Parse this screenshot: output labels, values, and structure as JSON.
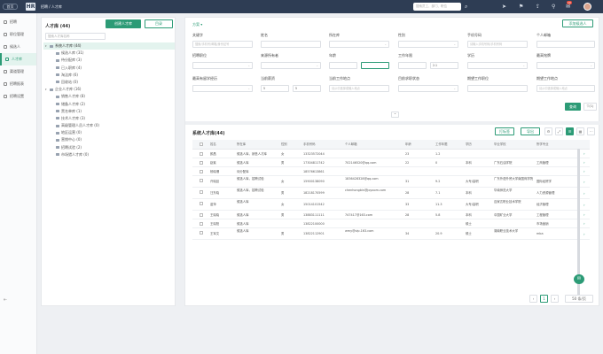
{
  "topbar": {
    "home_label": "首页",
    "logo": "HR",
    "breadcrumb": "招聘 / 人才库",
    "search_placeholder": "搜索员工、部门、职位",
    "notification_count": "10"
  },
  "nav": {
    "items": [
      {
        "label": "招聘",
        "name": "nav-recruit"
      },
      {
        "label": "职位管理",
        "name": "nav-jobs"
      },
      {
        "label": "候选人",
        "name": "nav-candidates"
      },
      {
        "label": "人才库",
        "name": "nav-talent-pool"
      },
      {
        "label": "渠道管理",
        "name": "nav-channels"
      },
      {
        "label": "招聘报表",
        "name": "nav-reports"
      },
      {
        "label": "招聘设置",
        "name": "nav-settings"
      }
    ]
  },
  "talent_panel": {
    "title": "人才库 (44)",
    "create_button": "创建人才库",
    "folder_button": "目录",
    "search_placeholder": "搜索人才库名称",
    "tree": [
      {
        "label": "系统人才库 (44)",
        "level": 1,
        "selected": true
      },
      {
        "label": "候选人库 (31)",
        "level": 2
      },
      {
        "label": "待分配库 (3)",
        "level": 2
      },
      {
        "label": "已入职库 (4)",
        "level": 2
      },
      {
        "label": "淘汰库 (6)",
        "level": 2
      },
      {
        "label": "回收站 (0)",
        "level": 2
      },
      {
        "label": "企业人才库 (16)",
        "level": 1
      },
      {
        "label": "销售人才库 (8)",
        "level": 2
      },
      {
        "label": "储备人才库 (2)",
        "level": 2
      },
      {
        "label": "黑名单库 (1)",
        "level": 2
      },
      {
        "label": "技术人才库 (3)",
        "level": 2
      },
      {
        "label": "高级管理人员人才库 (0)",
        "level": 2
      },
      {
        "label": "地区运营 (0)",
        "level": 2
      },
      {
        "label": "营销中心 (0)",
        "level": 2
      },
      {
        "label": "招聘试验 (2)",
        "level": 2
      },
      {
        "label": "市场猎人才库 (0)",
        "level": 2
      }
    ]
  },
  "filters": {
    "scheme_label": "方案 ▾",
    "add_candidate": "添加候选人",
    "rows": [
      [
        {
          "label": "关键字",
          "placeholder": "搜索/手机号/邮箱/身份证号",
          "select": false
        },
        {
          "label": "姓名",
          "placeholder": "",
          "select": false
        },
        {
          "label": "所在库",
          "placeholder": "",
          "select": true
        },
        {
          "label": "性别",
          "placeholder": "",
          "select": true
        },
        {
          "label": "手机号码",
          "placeholder": "请输入手机号码/手机号码",
          "select": false
        },
        {
          "label": "个人邮箱",
          "placeholder": "",
          "select": false
        }
      ],
      [
        {
          "label": "招聘职位",
          "placeholder": "",
          "select": true
        },
        {
          "label": "来源所有者",
          "placeholder": "",
          "select": true
        },
        {
          "label": "年龄",
          "placeholder": "",
          "select": false
        },
        {
          "label": "工作年限",
          "placeholder": "",
          "select": false
        },
        {
          "label": "学历",
          "placeholder": "",
          "select": true
        },
        {
          "label": "最高铭牌",
          "placeholder": "",
          "select": true
        }
      ],
      [
        {
          "label": "最高有留学经历",
          "placeholder": "",
          "select": true
        },
        {
          "label": "当前薪资",
          "placeholder": "",
          "select": false
        },
        {
          "label": "当前工作地点",
          "placeholder": "请从中选择或输入地点",
          "select": false
        },
        {
          "label": "目前求职状态",
          "placeholder": "",
          "select": true
        },
        {
          "label": "期望工作职位",
          "placeholder": "",
          "select": false
        },
        {
          "label": "期望工作地点",
          "placeholder": "请从中选择或输入地点",
          "select": false
        }
      ]
    ],
    "age_min": "",
    "age_max": "",
    "exp_min": "",
    "exp_max": "2.1",
    "salary_min": "5",
    "salary_max": "5",
    "query_button": "查询",
    "filter_button": "▽(1)"
  },
  "table": {
    "title": "系统人才库(44)",
    "tag_button": "打标签",
    "export_button": "导出",
    "headers": [
      "姓名",
      "所在库",
      "性别",
      "手机号码",
      "个人邮箱",
      "年龄",
      "工作年限",
      "学历",
      "毕业学校",
      "所学专业"
    ],
    "rows": [
      [
        "颜昌",
        "候选人库，销售人才库",
        "女",
        "13323572044",
        "",
        "23",
        "1.2",
        "",
        "",
        ""
      ],
      [
        "赵紫",
        "候选人库",
        "男",
        "17304811742",
        "702146520@qq.com",
        "22",
        "0",
        "本科",
        "广东石油学院",
        "工商管理"
      ],
      [
        "杨晓珊",
        "待分配库",
        "",
        "18576613861",
        "",
        "",
        "",
        "",
        "",
        ""
      ],
      [
        "许晓廷",
        "候选人库，招聘试验",
        "女",
        "15900138090",
        "1836428328@qq.com",
        "31",
        "9.2",
        "大专/高职",
        "广东外语外贸大学南国商学院",
        "国际经贸学"
      ],
      [
        "汪东晓",
        "候选人库，招聘试验",
        "男",
        "18218170599",
        "chenhongbin@joyoom.com",
        "28",
        "7.1",
        "本科",
        "华南师范大学",
        "人力资源管理"
      ],
      [
        "苗萍",
        "候选人库",
        "女",
        "15014101542",
        "",
        "33",
        "11.3",
        "大专/高职",
        "百家达职业技术学院",
        "经济管理"
      ],
      [
        "王晓晓",
        "候选人库",
        "男",
        "13883111111",
        "747417@163.com",
        "28",
        "5.8",
        "本科",
        "中国矿业大学",
        "工程管理"
      ],
      [
        "王晓阳",
        "候选人库",
        "",
        "13822100000",
        "",
        "",
        "",
        "硕士",
        "",
        "市场营销"
      ],
      [
        "王军文",
        "候选人库",
        "男",
        "13822112901",
        "wmy@vip.163.com",
        "34",
        "20.9",
        "硕士",
        "湖南职业技术大学",
        "mba"
      ]
    ]
  },
  "pagination": {
    "current": "1",
    "page_size": "50 条/页"
  }
}
